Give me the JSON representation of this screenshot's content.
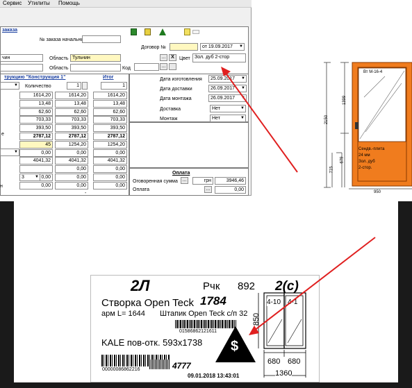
{
  "menu": {
    "items": [
      "Сервис",
      "Утилиты",
      "Помощь"
    ]
  },
  "order": {
    "group_title": "заказа",
    "initial_order_label": "№ заказа начальный",
    "contract_label": "Договор №",
    "contract_date": "от 19.09.2017",
    "city_value": "чин",
    "region_label": "Область",
    "region_value": "Тульчин",
    "region2_label": "Область",
    "color_label": "Цвет",
    "color_value": "Зол. дуб 2-стор",
    "code_label": "Код",
    "x_mark": "X",
    "dots": "..."
  },
  "construction": {
    "header": "трукцию \"Конструкция 1\"",
    "total_header": "Итог",
    "qty_label": "Количество",
    "qty_value": "1",
    "total_qty": "1",
    "rows": [
      {
        "a": "1614,20",
        "b": "1614,20",
        "c": "1614,20"
      },
      {
        "a": "13,48",
        "b": "13,48",
        "c": "13,48"
      },
      {
        "a": "62,60",
        "b": "62,60",
        "c": "62,60"
      },
      {
        "a": "703,33",
        "b": "703,33",
        "c": "703,33"
      },
      {
        "a": "393,50",
        "b": "393,50",
        "c": "393,50"
      },
      {
        "a": "2787,12",
        "b": "2787,12",
        "c": "2787,12"
      },
      {
        "a": "45",
        "b": "1254,20",
        "c": "1254,20"
      },
      {
        "a": "0,00",
        "b": "0,00",
        "c": "0,00"
      },
      {
        "a": "4041,32",
        "b": "4041,32",
        "c": "4041,32"
      },
      {
        "a": "",
        "b": "0,00",
        "c": "0,00"
      },
      {
        "a": "0,00",
        "b": "0,00",
        "c": "0,00"
      },
      {
        "a": "0,00",
        "b": "0,00",
        "c": "0,00"
      }
    ],
    "side_letter_1": "е",
    "side_letter_2": "н",
    "small_dd_value": "3",
    "minus": "-"
  },
  "dates": {
    "manufacture_label": "Дата изготовления",
    "manufacture_value": "25.09.2017",
    "delivery_label": "Дата доставки",
    "delivery_value": "26.09.2017",
    "install_label": "Дата монтажа",
    "install_value": "26.09.2017",
    "shipping_label": "Доставка",
    "shipping_value": "Нет",
    "mount_label": "Монтаж",
    "mount_value": "Нет"
  },
  "payment": {
    "title": "Оплата",
    "agreed_label": "Оговоренная сумма",
    "currency": "грн",
    "agreed_value": "3946,46",
    "pay_label": "Оплата",
    "pay_value": "0,00"
  },
  "drawing": {
    "profile_label": "Вт М-16-4",
    "dim_total": "2150",
    "dim_top": "1399",
    "dim_715": "715",
    "dim_679": "679",
    "dim_width": "950",
    "panel_lines": [
      "Сендв.-плита",
      "24 мм",
      "Зол. дуб",
      "2-стор."
    ]
  },
  "label": {
    "code": "2Л",
    "handle_label": "Рчк",
    "handle_value": "892",
    "side": "2(с)",
    "sash_line": "Створка  Open Teck",
    "sash_number": "1784",
    "arm_line": "арм  L=  1644",
    "bead_line": "Штапик Open Teck с/п 32",
    "barcode1_digits": "01586862121611",
    "kale_line": "KALE пов-отк. 593х1738",
    "barcode2_digits": "00000086862216",
    "number_4777": "4777",
    "datetime": "09.01.2018 13:43:01",
    "dim_850": "850",
    "dim_680a": "680",
    "dim_680b": "680",
    "dim_1360": "1360",
    "mini_left": "4-10",
    "mini_right": "4-1",
    "dollar": "$"
  },
  "colors": {
    "accent_orange": "#f07c1e",
    "arrow_red": "#e02020",
    "highlight_yellow": "#fff8c0"
  }
}
